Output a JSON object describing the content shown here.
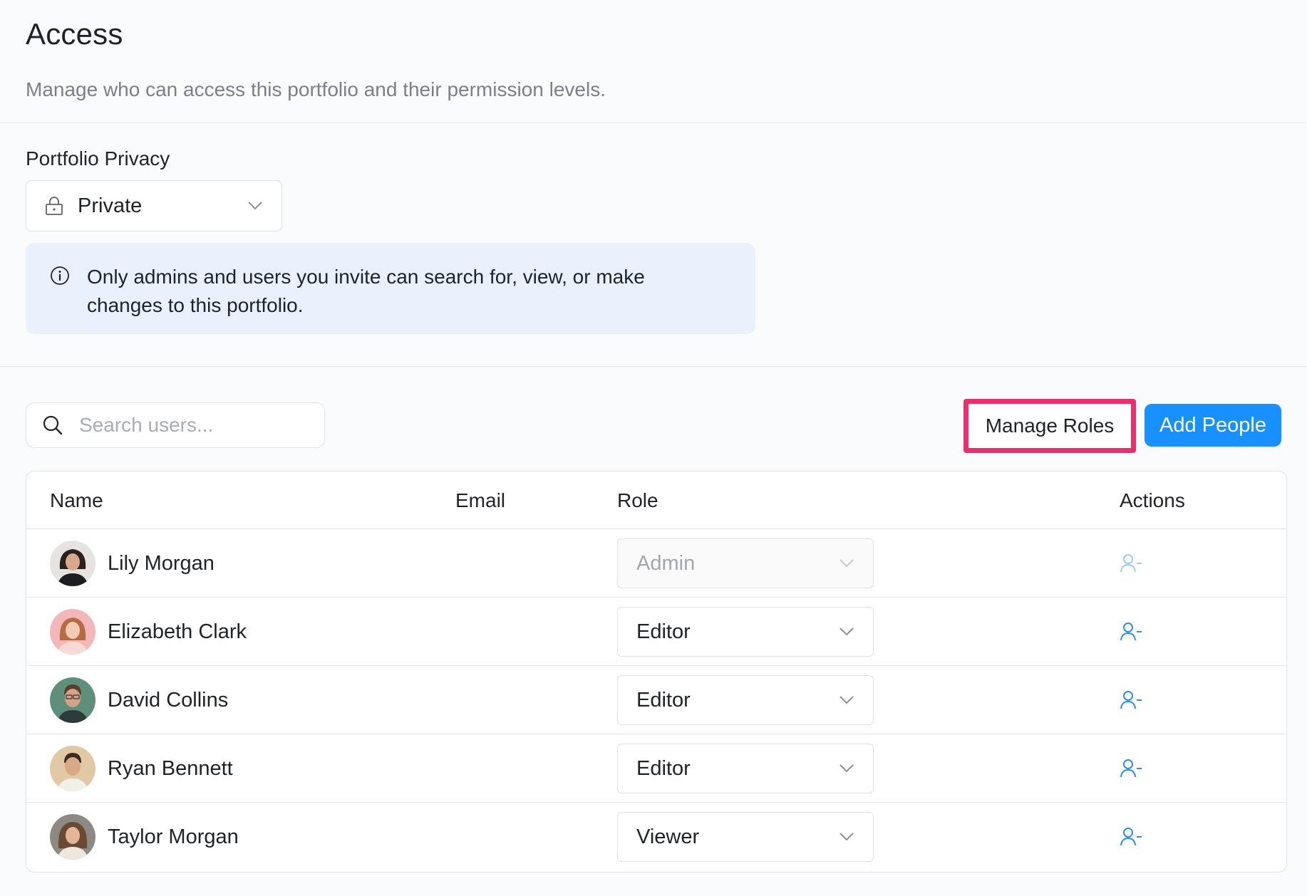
{
  "header": {
    "title": "Access",
    "subtitle": "Manage who can access this portfolio and their permission levels."
  },
  "privacy": {
    "label": "Portfolio Privacy",
    "value": "Private",
    "icon": "lock-icon",
    "info_text": "Only admins and users you invite can search for, view, or make changes to this portfolio."
  },
  "toolbar": {
    "search_placeholder": "Search users...",
    "manage_roles_label": "Manage Roles",
    "add_people_label": "Add People"
  },
  "table": {
    "columns": [
      "Name",
      "Email",
      "Role",
      "Actions"
    ],
    "rows": [
      {
        "name": "Lily Morgan",
        "email": "",
        "role": "Admin",
        "role_disabled": true
      },
      {
        "name": "Elizabeth Clark",
        "email": "",
        "role": "Editor",
        "role_disabled": false
      },
      {
        "name": "David Collins",
        "email": "",
        "role": "Editor",
        "role_disabled": false
      },
      {
        "name": "Ryan Bennett",
        "email": "",
        "role": "Editor",
        "role_disabled": false
      },
      {
        "name": "Taylor Morgan",
        "email": "",
        "role": "Viewer",
        "role_disabled": false
      }
    ]
  },
  "colors": {
    "primary": "#1890ff",
    "highlight_border": "#ef2d6d",
    "info_bg": "#e9f2fc",
    "action_icon": "#2f8fe6"
  }
}
